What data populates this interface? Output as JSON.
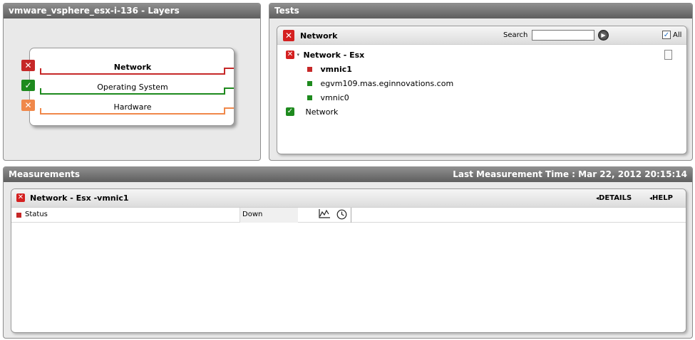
{
  "layers": {
    "title": "vmware_vsphere_esx-i-136  - Layers",
    "items": [
      {
        "label": "Network",
        "status": "critical",
        "color": "#c62828",
        "bold": true
      },
      {
        "label": "Operating System",
        "status": "ok",
        "color": "#1e8a1e",
        "bold": false
      },
      {
        "label": "Hardware",
        "status": "unknown",
        "color": "#f0884a",
        "bold": false
      }
    ]
  },
  "tests": {
    "title": "Tests",
    "selected_layer": "Network",
    "search_label": "Search",
    "search_value": "",
    "all_label": "All",
    "all_checked": true,
    "tree": {
      "group_label": "Network - Esx",
      "children": [
        {
          "label": "vmnic1",
          "color": "#c62828",
          "bold": true
        },
        {
          "label": "egvm109.mas.eginnovations.com",
          "color": "#1e8a1e",
          "bold": false
        },
        {
          "label": "vmnic0",
          "color": "#1e8a1e",
          "bold": false
        }
      ],
      "second_group_label": "Network"
    }
  },
  "measurements": {
    "title": "Measurements",
    "last_time": "Last Measurement Time : Mar 22, 2012 20:15:14",
    "test_title": "Network - Esx -vmnic1",
    "details_label": "DETAILS",
    "help_label": "HELP",
    "rows": [
      {
        "name": "Status",
        "value": "Down",
        "color": "#c62828"
      }
    ]
  },
  "colors": {
    "critical": "#c62828",
    "ok": "#1e8a1e",
    "unknown": "#f0884a"
  }
}
